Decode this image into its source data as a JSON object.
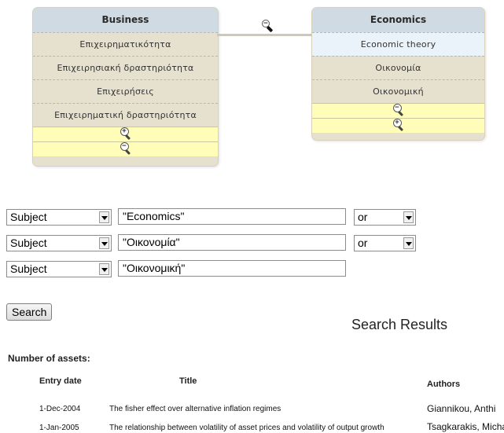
{
  "left_box": {
    "header": "Business",
    "terms": [
      "Επιχειρηματικότητα",
      "Επιχειρησιακή δραστηριότητα",
      "Επιχειρήσεις",
      "Επιχειρηματική δραστηριότητα"
    ],
    "zoom_in_icon": "zoom-in-icon",
    "zoom_out_icon": "zoom-out-icon"
  },
  "right_box": {
    "header": "Economics",
    "terms": [
      "Economic theory",
      "Οικονομία",
      "Οικονομική"
    ],
    "selected_term": "Economic theory",
    "zoom_out_icon": "zoom-out-icon",
    "zoom_in_icon": "zoom-in-icon"
  },
  "connector_icon": "zoom-out-icon",
  "search_form": {
    "rows": [
      {
        "field": "Subject",
        "value": "\"Economics\"",
        "operator": "or"
      },
      {
        "field": "Subject",
        "value": "\"Οικονομία\"",
        "operator": "or"
      },
      {
        "field": "Subject",
        "value": "\"Οικονομική\""
      }
    ],
    "search_label": "Search"
  },
  "results": {
    "title": "Search Results",
    "count_label": "Number of assets:",
    "columns": {
      "date": "Entry date",
      "title": "Title",
      "authors": "Authors"
    },
    "rows": [
      {
        "date": "1-Dec-2004",
        "title": "The fisher effect over alternative inflation regimes",
        "authors": "Giannikou, Anthi"
      },
      {
        "date": "1-Jan-2005",
        "title": "The relationship between volatility of asset prices and volatility of output growth",
        "authors": "Tsagkarakis, Michail"
      }
    ]
  },
  "colors": {
    "box_header": "#cfdae3",
    "box_body": "#e6e1cf",
    "zoom_row": "#fffdb8",
    "selected_row": "#eaf3fa"
  }
}
